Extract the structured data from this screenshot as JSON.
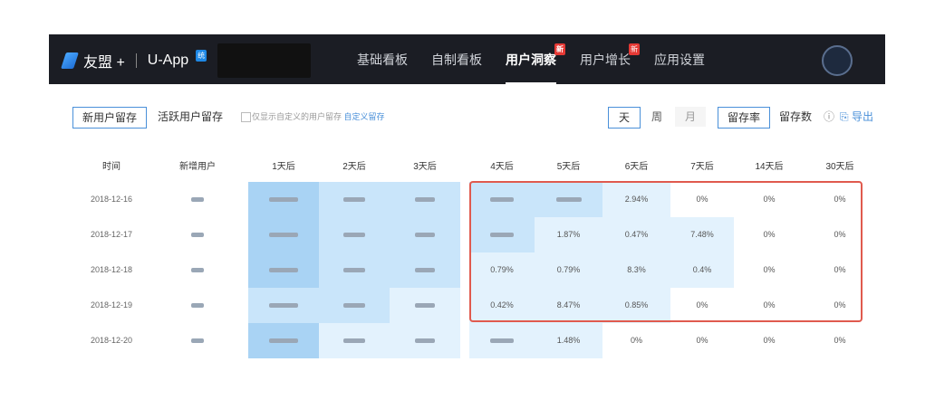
{
  "header": {
    "brand": "友盟 +",
    "product": "U-App",
    "product_badge": "统",
    "nav": [
      {
        "label": "基础看板"
      },
      {
        "label": "自制看板"
      },
      {
        "label": "用户洞察",
        "badge": "新"
      },
      {
        "label": "用户增长",
        "badge": "新"
      },
      {
        "label": "应用设置"
      }
    ]
  },
  "toolbar": {
    "tabs": [
      {
        "label": "新用户留存"
      },
      {
        "label": "活跃用户留存"
      }
    ],
    "hint_prefix": "仅显示自定义的用户留存",
    "hint_link": "自定义留存",
    "period": [
      {
        "label": "天"
      },
      {
        "label": "周"
      },
      {
        "label": "月"
      }
    ],
    "metric": [
      {
        "label": "留存率"
      },
      {
        "label": "留存数"
      }
    ],
    "export": "导出"
  },
  "table": {
    "columns": [
      "时间",
      "新增用户",
      "1天后",
      "2天后",
      "3天后",
      "4天后",
      "5天后",
      "6天后",
      "7天后",
      "14天后",
      "30天后"
    ],
    "rows": [
      {
        "date": "2018-12-16",
        "values": [
          "",
          "",
          "",
          "",
          "",
          "2.94%",
          "0%",
          "0%",
          "0%"
        ]
      },
      {
        "date": "2018-12-17",
        "values": [
          "",
          "",
          "",
          "",
          "1.87%",
          "0.47%",
          "7.48%",
          "0%",
          "0%"
        ]
      },
      {
        "date": "2018-12-18",
        "values": [
          "",
          "",
          "",
          "0.79%",
          "0.79%",
          "8.3%",
          "0.4%",
          "0%",
          "0%"
        ]
      },
      {
        "date": "2018-12-19",
        "values": [
          "",
          "",
          "",
          "0.42%",
          "8.47%",
          "0.85%",
          "0%",
          "0%",
          "0%"
        ]
      },
      {
        "date": "2018-12-20",
        "values": [
          "",
          "",
          "",
          "",
          "1.48%",
          "0%",
          "0%",
          "0%",
          "0%"
        ]
      }
    ]
  },
  "colors": {
    "topbar": "#1b1d24",
    "accent": "#4a90d9",
    "highlight_border": "#e05a4e",
    "heat_strong": "#a9d3f4",
    "heat_mid": "#c9e5fa",
    "heat_light": "#e3f2fd"
  }
}
